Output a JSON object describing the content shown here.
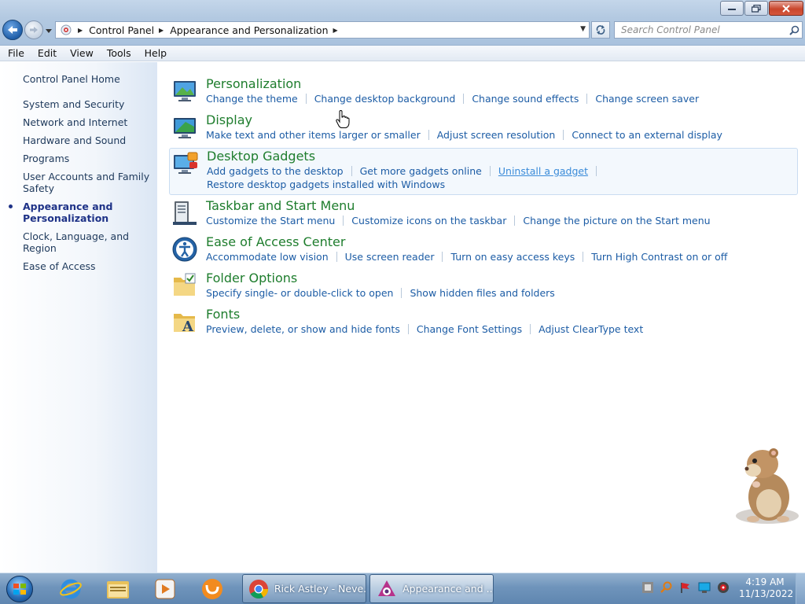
{
  "window": {
    "breadcrumb": [
      "Control Panel",
      "Appearance and Personalization"
    ],
    "search_placeholder": "Search Control Panel"
  },
  "menubar": [
    "File",
    "Edit",
    "View",
    "Tools",
    "Help"
  ],
  "leftpane": {
    "home": "Control Panel Home",
    "items": [
      {
        "label": "System and Security",
        "current": false
      },
      {
        "label": "Network and Internet",
        "current": false
      },
      {
        "label": "Hardware and Sound",
        "current": false
      },
      {
        "label": "Programs",
        "current": false
      },
      {
        "label": "User Accounts and Family Safety",
        "current": false
      },
      {
        "label": "Appearance and Personalization",
        "current": true
      },
      {
        "label": "Clock, Language, and Region",
        "current": false
      },
      {
        "label": "Ease of Access",
        "current": false
      }
    ]
  },
  "categories": [
    {
      "title": "Personalization",
      "icon": "personalization-icon",
      "lines": [
        [
          "Change the theme",
          "Change desktop background",
          "Change sound effects",
          "Change screen saver"
        ]
      ]
    },
    {
      "title": "Display",
      "icon": "display-icon",
      "lines": [
        [
          "Make text and other items larger or smaller",
          "Adjust screen resolution",
          "Connect to an external display"
        ]
      ]
    },
    {
      "title": "Desktop Gadgets",
      "icon": "desktop-gadgets-icon",
      "highlighted": true,
      "lines": [
        [
          "Add gadgets to the desktop",
          "Get more gadgets online",
          "Uninstall a gadget"
        ],
        [
          "Restore desktop gadgets installed with Windows"
        ]
      ]
    },
    {
      "title": "Taskbar and Start Menu",
      "icon": "taskbar-icon",
      "lines": [
        [
          "Customize the Start menu",
          "Customize icons on the taskbar",
          "Change the picture on the Start menu"
        ]
      ]
    },
    {
      "title": "Ease of Access Center",
      "icon": "ease-of-access-icon",
      "lines": [
        [
          "Accommodate low vision",
          "Use screen reader",
          "Turn on easy access keys",
          "Turn High Contrast on or off"
        ]
      ]
    },
    {
      "title": "Folder Options",
      "icon": "folder-options-icon",
      "lines": [
        [
          "Specify single- or double-click to open",
          "Show hidden files and folders"
        ]
      ]
    },
    {
      "title": "Fonts",
      "icon": "fonts-icon",
      "lines": [
        [
          "Preview, delete, or show and hide fonts",
          "Change Font Settings",
          "Adjust ClearType text"
        ]
      ]
    }
  ],
  "taskbar": {
    "tasks": [
      {
        "label": "Rick Astley - Neve...",
        "icon": "chrome-icon"
      },
      {
        "label": "Appearance and ...",
        "icon": "control-panel-icon"
      }
    ],
    "clock": {
      "time": "4:19 AM",
      "date": "11/13/2022"
    }
  },
  "colors": {
    "category_title": "#1e7d2d",
    "link": "#1c5ca5",
    "hover_link": "#3a8bd9"
  }
}
